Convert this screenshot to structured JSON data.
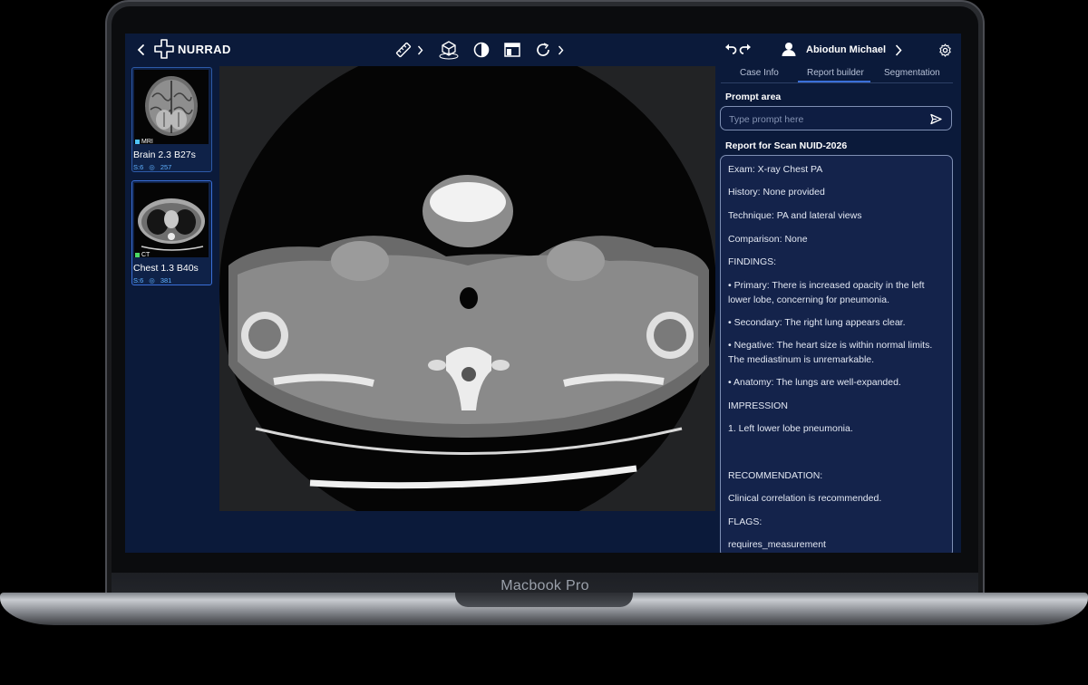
{
  "device_label": "Macbook Pro",
  "app": {
    "logo_text": "NURRAD",
    "toolbar_icons": [
      "back-chevron-icon",
      "ruler-icon",
      "chevron-right-icon",
      "cube-3d-icon",
      "contrast-icon",
      "layout-icon",
      "rotate-icon",
      "chevron-right-icon"
    ],
    "history_icons": [
      "undo-icon",
      "redo-icon"
    ],
    "user": {
      "name": "Abiodun Michael"
    },
    "accent_color": "#3a6fd8",
    "background_color": "#0b1a3a"
  },
  "series_list": [
    {
      "modality": "MRI",
      "modality_color": "#4fc3f7",
      "title": "Brain 2.3 B27s",
      "series_label": "S:6",
      "count": "257"
    },
    {
      "modality": "CT",
      "modality_color": "#4cd964",
      "title": "Chest 1.3 B40s",
      "series_label": "S:6",
      "count": "381"
    }
  ],
  "tabs": {
    "case_info": "Case Info",
    "report_builder": "Report builder",
    "segmentation": "Segmentation",
    "active": "Report builder"
  },
  "prompt": {
    "label": "Prompt area",
    "placeholder": "Type prompt here"
  },
  "report": {
    "heading": "Report for Scan NUID-2026",
    "lines": [
      "Exam: X-ray Chest PA",
      "History: None provided",
      "Technique: PA and lateral views",
      "Comparison: None",
      "FINDINGS:",
      "• Primary: There is increased opacity in the left lower lobe, concerning for pneumonia.",
      "• Secondary: The right lung appears clear.",
      "• Negative: The heart size is within normal limits. The mediastinum is unremarkable.",
      "• Anatomy: The lungs are well-expanded.",
      "IMPRESSION",
      "1. Left lower lobe pneumonia.",
      "RECOMMENDATION:",
      "Clinical correlation is recommended.",
      "FLAGS:",
      "requires_measurement"
    ]
  }
}
